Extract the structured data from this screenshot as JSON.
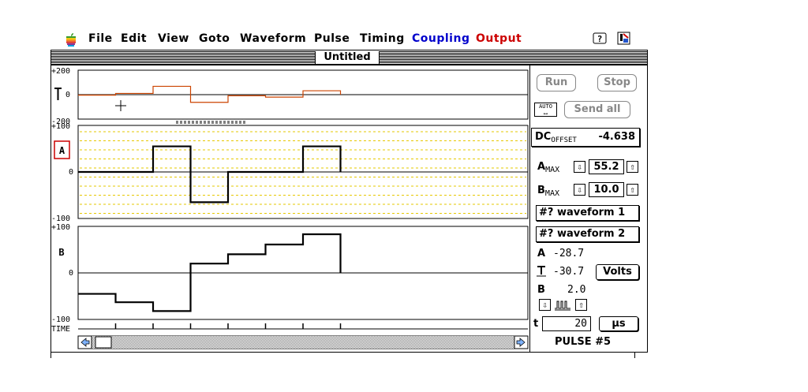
{
  "menubar": {
    "apple_icon": "apple-icon",
    "items": [
      {
        "label": "File",
        "color": "#000000"
      },
      {
        "label": "Edit",
        "color": "#000000"
      },
      {
        "label": "View",
        "color": "#000000"
      },
      {
        "label": "Goto",
        "color": "#000000"
      },
      {
        "label": "Waveform",
        "color": "#000000"
      },
      {
        "label": "Pulse",
        "color": "#000000"
      },
      {
        "label": "Timing",
        "color": "#000000"
      },
      {
        "label": "Coupling",
        "color": "#0000cc"
      },
      {
        "label": "Output",
        "color": "#cc0000"
      }
    ],
    "help_icon": "help-icon",
    "app_icon": "app-icon"
  },
  "window": {
    "title": "Untitled"
  },
  "plots": {
    "top": {
      "ymax": "+200",
      "zero": "0",
      "ymin": "-200"
    },
    "a": {
      "label": "A",
      "ymax": "+100",
      "zero": "0",
      "ymin": "-100"
    },
    "b": {
      "label": "B",
      "ymax": "+100",
      "zero": "0",
      "ymin": "-100"
    },
    "time_label": "TIME"
  },
  "controls": {
    "run": "Run",
    "stop": "Stop",
    "auto": "AUTO",
    "send_all": "Send all",
    "dc_offset_label": "DC",
    "dc_offset_sub": "OFFSET",
    "dc_offset_value": "-4.638",
    "amax_label": "A",
    "amax_sub": "MAX",
    "amax_value": "55.2",
    "bmax_label": "B",
    "bmax_sub": "MAX",
    "bmax_value": "10.0",
    "waveform1": "#? waveform 1",
    "waveform2": "#? waveform 2",
    "a_readout_label": "A",
    "a_readout_value": "-28.7",
    "offset_readout_value": "-30.7",
    "volts": "Volts",
    "b_readout_label": "B",
    "b_readout_value": "2.0",
    "t_label": "t",
    "t_value": "20",
    "t_unit": "µs",
    "pulse": "PULSE #5"
  },
  "chart_data": {
    "type": "line",
    "x": [
      0,
      1,
      2,
      3,
      4,
      5,
      6,
      7
    ],
    "series": [
      {
        "name": "",
        "color": "#cc4400",
        "values": [
          -4,
          10,
          68,
          -63,
          -9,
          -20,
          32,
          0
        ]
      },
      {
        "name": "",
        "color": "#000000",
        "values": [
          0,
          0,
          55,
          -65,
          0,
          0,
          55,
          0
        ]
      },
      {
        "name": "",
        "color": "#000000",
        "values": [
          -45,
          -63,
          -82,
          20,
          40,
          61,
          83,
          0
        ]
      }
    ]
  }
}
